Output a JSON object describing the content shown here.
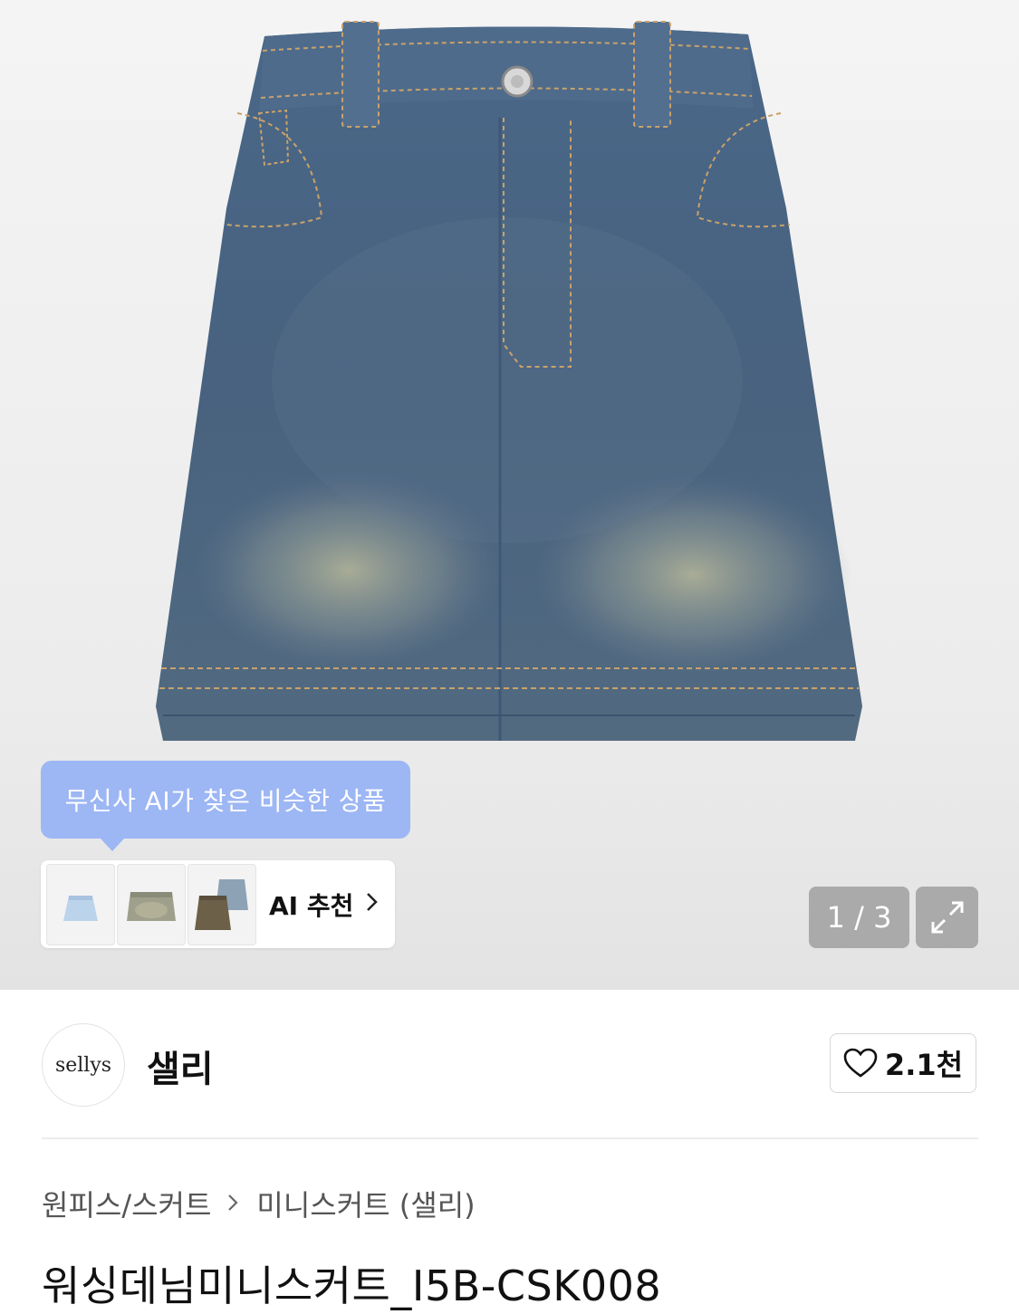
{
  "ai_bubble": {
    "text": "무신사 AI가 찾은 비슷한 상품"
  },
  "ai_recommend": {
    "link_label": "AI 추천",
    "thumbnails": [
      "light-denim-skirt",
      "washed-denim-skirt",
      "two-denim-skirts"
    ]
  },
  "gallery": {
    "counter": "1 / 3"
  },
  "brand": {
    "logo_text": "sellys",
    "name": "샐리"
  },
  "like": {
    "count": "2.1천"
  },
  "breadcrumb": {
    "category": "원피스/스커트",
    "subcategory": "미니스커트 (샐리)"
  },
  "product": {
    "title": "워싱데님미니스커트_I5B-CSK008"
  },
  "colors": {
    "ai_bubble": "#9db6f4",
    "denim": "#4a6585"
  }
}
